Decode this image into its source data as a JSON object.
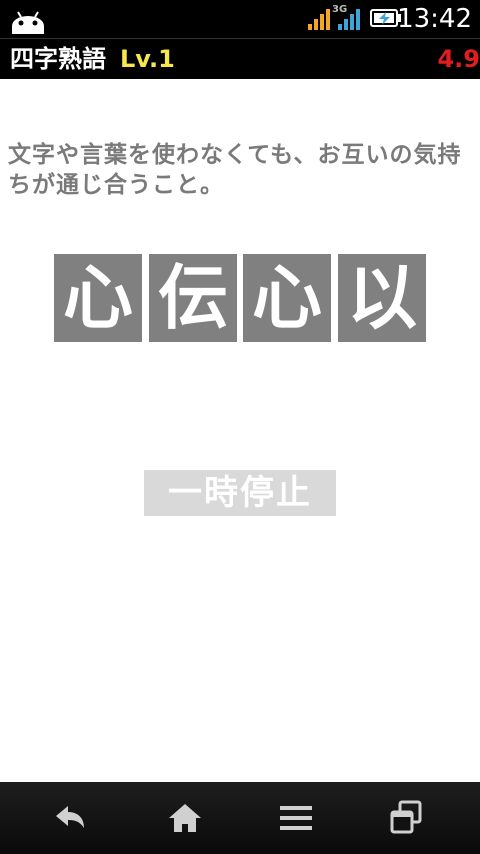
{
  "status_bar": {
    "time": "13:42",
    "network_label": "3G",
    "icons": [
      "android-icon",
      "signal-icon",
      "signal-3g-icon",
      "battery-charging-icon"
    ]
  },
  "header": {
    "title": "四字熟語",
    "level": "Lv.1",
    "timer": "4.9"
  },
  "question": {
    "meaning": "文字や言葉を使わなくても、お互いの気持ちが通じ合うこと。"
  },
  "tiles": [
    "心",
    "伝",
    "心",
    "以"
  ],
  "pause_button": {
    "label": "一時停止"
  },
  "nav": {
    "icons": [
      "back-icon",
      "home-icon",
      "menu-icon",
      "recent-apps-icon"
    ]
  },
  "colors": {
    "tile": "#808080",
    "level": "#f6e84a",
    "timer": "#e21d1d",
    "pause_button": "#d9d9d9"
  }
}
